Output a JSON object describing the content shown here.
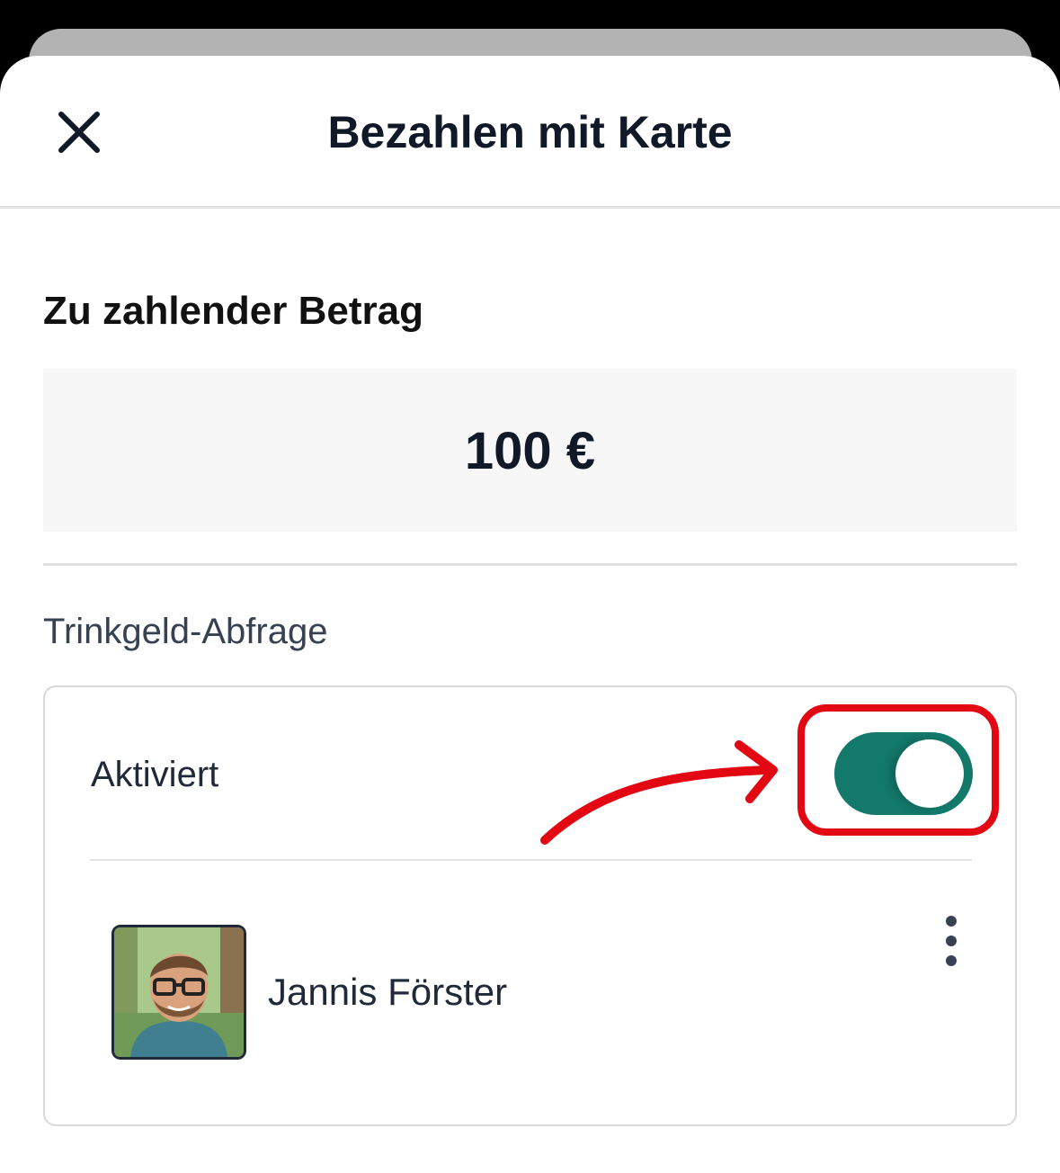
{
  "header": {
    "title": "Bezahlen mit Karte",
    "close_icon": "close-icon"
  },
  "amount": {
    "label": "Zu zahlender Betrag",
    "value": "100 €"
  },
  "tip": {
    "section_label": "Trinkgeld-Abfrage",
    "toggle_label": "Aktiviert",
    "toggle_on": true,
    "toggle_color": "#12796b",
    "highlight_color": "#e30613",
    "employee": {
      "name": "Jannis Förster",
      "avatar_icon": "avatar",
      "menu_icon": "more-vertical-icon"
    }
  }
}
